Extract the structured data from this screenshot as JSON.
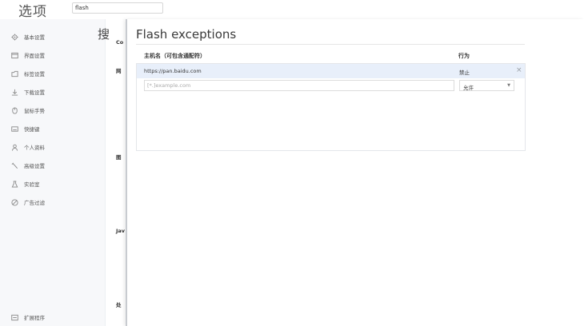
{
  "app": {
    "title": "选项"
  },
  "search": {
    "value": "flash"
  },
  "sidebar": {
    "items": [
      {
        "label": "基本设置",
        "icon": "gear-icon"
      },
      {
        "label": "界面设置",
        "icon": "window-icon"
      },
      {
        "label": "标签设置",
        "icon": "tab-icon"
      },
      {
        "label": "下载设置",
        "icon": "download-icon"
      },
      {
        "label": "鼠标手势",
        "icon": "mouse-icon"
      },
      {
        "label": "快捷键",
        "icon": "keyboard-icon"
      },
      {
        "label": "个人资料",
        "icon": "person-icon"
      },
      {
        "label": "高级设置",
        "icon": "advanced-icon"
      },
      {
        "label": "实验室",
        "icon": "lab-icon"
      },
      {
        "label": "广告过滤",
        "icon": "block-icon"
      }
    ],
    "footer": {
      "label": "扩展程序",
      "icon": "extension-icon"
    }
  },
  "background": {
    "title_fragment": "搜",
    "fragments": [
      "Co",
      "网",
      "图",
      "Jav",
      "处"
    ]
  },
  "dialog": {
    "title": "Flash exceptions",
    "columns": {
      "host": "主机名（可包含通配符）",
      "action": "行为"
    },
    "rows": [
      {
        "host": "https://pan.baidu.com",
        "action": "禁止",
        "remove": "×"
      }
    ],
    "new_row": {
      "placeholder": "[*.]example.com",
      "action_selected": "允许",
      "caret": "▼"
    }
  }
}
